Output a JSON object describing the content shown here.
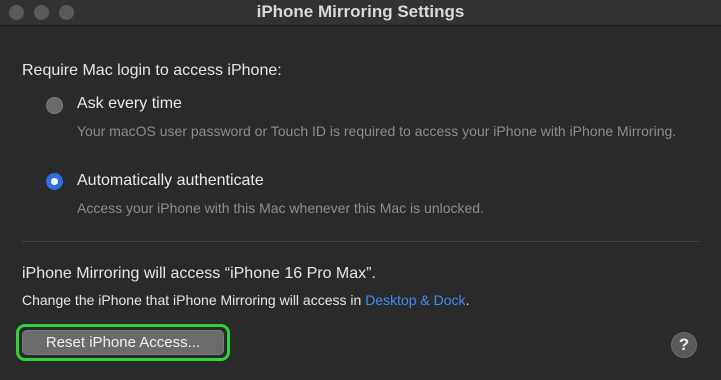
{
  "window": {
    "title": "iPhone Mirroring Settings"
  },
  "login": {
    "heading": "Require Mac login to access iPhone:",
    "options": [
      {
        "label": "Ask every time",
        "description": "Your macOS user password or Touch ID is required to access your iPhone with iPhone Mirroring.",
        "selected": false
      },
      {
        "label": "Automatically authenticate",
        "description": "Access your iPhone with this Mac whenever this Mac is unlocked.",
        "selected": true
      }
    ]
  },
  "device": {
    "access_text": "iPhone Mirroring will access “iPhone 16 Pro Max”.",
    "change_prefix": "Change the iPhone that iPhone Mirroring will access in ",
    "change_link": "Desktop & Dock",
    "change_suffix": "."
  },
  "buttons": {
    "reset_label": "Reset iPhone Access...",
    "help_label": "?"
  },
  "colors": {
    "accent": "#2f6fdb",
    "link": "#3f8ef7",
    "highlight": "#2fd43a"
  }
}
